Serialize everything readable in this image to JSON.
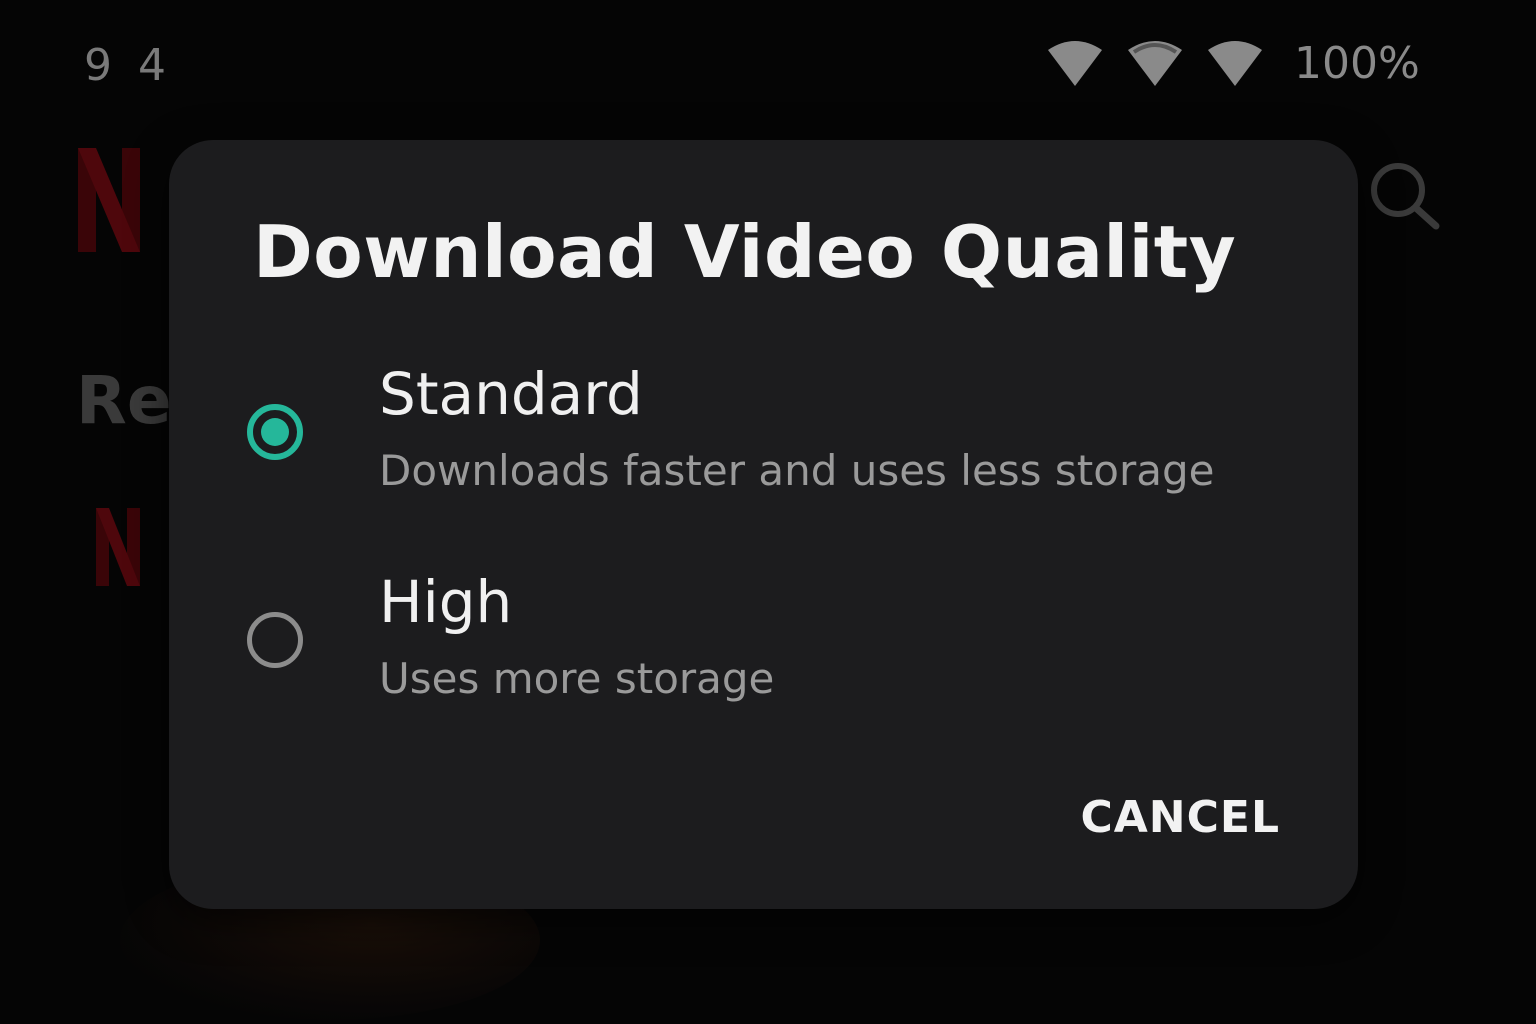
{
  "status_bar": {
    "time": "9 4",
    "battery": "100%",
    "icons": [
      "wifi-icon",
      "wifi-icon",
      "wifi-icon"
    ]
  },
  "background": {
    "logo_letter": "N",
    "row_title": "Re",
    "brand_color": "#b1060f"
  },
  "dialog": {
    "title": "Download Video Quality",
    "accent_color": "#25b79a",
    "options": [
      {
        "label": "Standard",
        "description": "Downloads faster and uses less storage",
        "selected": true
      },
      {
        "label": "High",
        "description": "Uses more storage",
        "selected": false
      }
    ],
    "cancel_label": "CANCEL"
  }
}
